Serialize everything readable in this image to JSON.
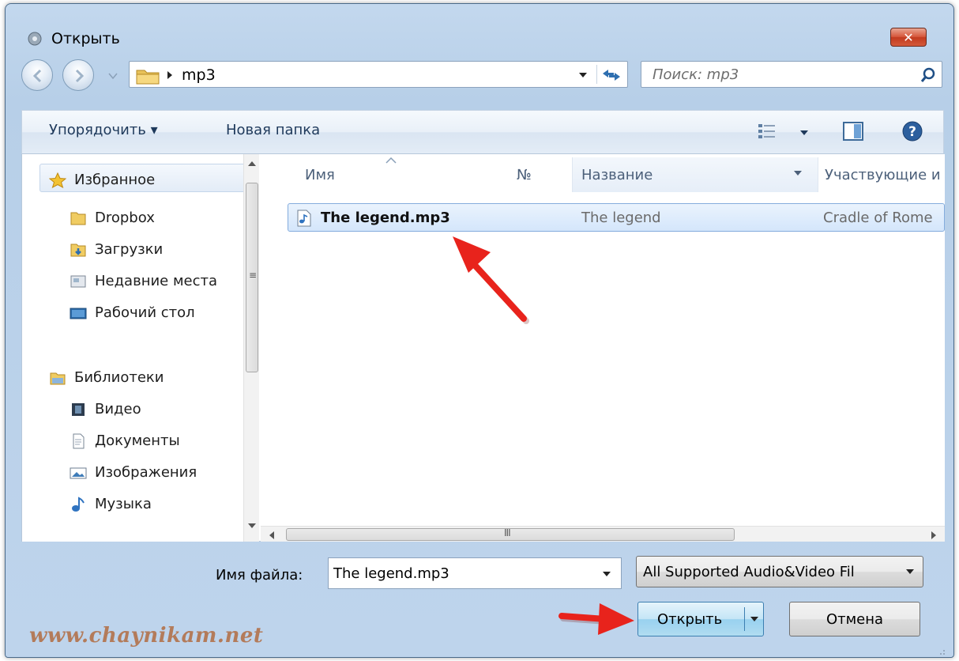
{
  "window": {
    "title": "Открыть",
    "close_label": "✕"
  },
  "address": {
    "crumb": "mp3",
    "search_placeholder": "Поиск: mp3"
  },
  "toolbar": {
    "organize": "Упорядочить ▾",
    "new_folder": "Новая папка"
  },
  "nav": {
    "favorites": "Избранное",
    "favorites_items": [
      "Dropbox",
      "Загрузки",
      "Недавние места",
      "Рабочий стол"
    ],
    "libraries": "Библиотеки",
    "libraries_items": [
      "Видео",
      "Документы",
      "Изображения",
      "Музыка"
    ]
  },
  "columns": {
    "name": "Имя",
    "number": "№",
    "title": "Название",
    "artists": "Участвующие и"
  },
  "files": [
    {
      "name": "The legend.mp3",
      "title": "The legend",
      "artist": "Cradle of Rome"
    }
  ],
  "bottom": {
    "filename_label": "Имя файла:",
    "filename_value": "The legend.mp3",
    "filter_value": "All Supported Audio&Video Fil",
    "open_label": "Открыть",
    "cancel_label": "Отмена"
  },
  "watermark": "www.chaynikam.net",
  "colors": {
    "window_frame": "#bed4ec",
    "selection": "#d4e6fb",
    "arrow": "#e8231c",
    "watermark": "#b37b5a"
  }
}
